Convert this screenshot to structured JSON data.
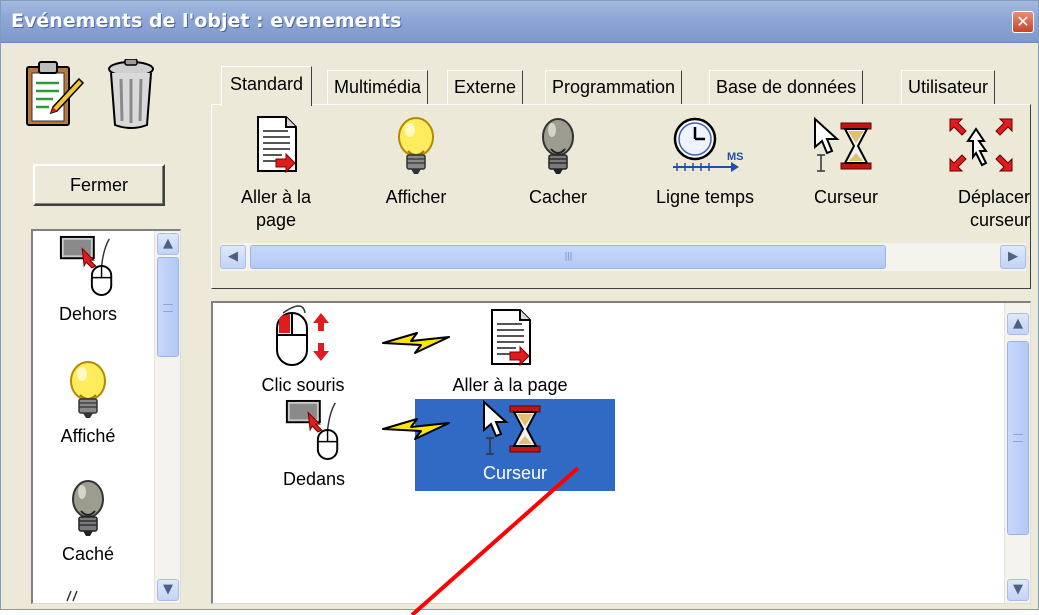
{
  "window": {
    "title": "Evénements de l'objet : evenements",
    "close_label": "✕"
  },
  "left": {
    "close_button": "Fermer",
    "list_items": [
      {
        "label": "Dehors",
        "icon": "mouse-out-icon"
      },
      {
        "label": "Affiché",
        "icon": "lightbulb-on-icon"
      },
      {
        "label": "Caché",
        "icon": "lightbulb-off-icon"
      }
    ]
  },
  "tabs": [
    "Standard",
    "Multimédia",
    "Externe",
    "Programmation",
    "Base de données",
    "Utilisateur"
  ],
  "active_tab": "Standard",
  "tools": [
    {
      "label_line1": "Aller à la",
      "label_line2": "page",
      "icon": "goto-page-icon"
    },
    {
      "label_line1": "Afficher",
      "label_line2": "",
      "icon": "lightbulb-on-icon"
    },
    {
      "label_line1": "Cacher",
      "label_line2": "",
      "icon": "lightbulb-off-icon"
    },
    {
      "label_line1": "Ligne temps",
      "label_line2": "",
      "icon": "timeline-clock-icon"
    },
    {
      "label_line1": "Curseur",
      "label_line2": "",
      "icon": "cursor-hourglass-icon"
    },
    {
      "label_line1": "Déplacer",
      "label_line2": "curseur",
      "icon": "move-cursor-icon"
    }
  ],
  "hscroll": {
    "grip": "III"
  },
  "canvas": {
    "nodes": [
      {
        "label": "Clic souris",
        "icon": "mouse-click-icon"
      },
      {
        "label": "Aller à la page",
        "icon": "goto-page-icon"
      },
      {
        "label": "Dedans",
        "icon": "mouse-in-icon"
      },
      {
        "label": "Curseur",
        "icon": "cursor-hourglass-icon",
        "selected": true
      }
    ],
    "links": [
      "lightning-link-icon",
      "lightning-link-icon"
    ]
  },
  "colors": {
    "title_bar": "#8fa8d6",
    "window_bg": "#ece9d8",
    "selection": "#316ac5",
    "annotation_line": "#ff0000",
    "bulb_on": "#ffe34d"
  }
}
